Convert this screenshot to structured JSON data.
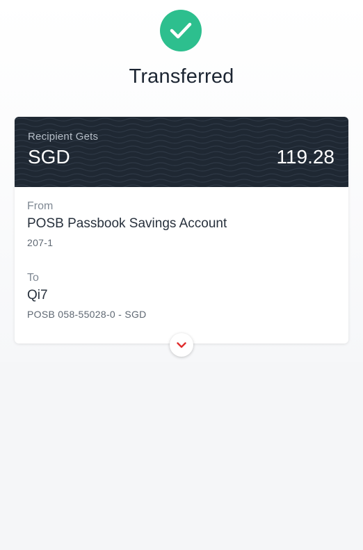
{
  "header": {
    "status_icon": "check-circle-icon",
    "status_color": "#2dbf8e",
    "title": "Transferred"
  },
  "card": {
    "header_bg": "#1f2833",
    "recipient_label": "Recipient Gets",
    "currency": "SGD",
    "amount": "119.28",
    "from": {
      "label": "From",
      "account_name": "POSB Passbook Savings Account",
      "account_number": "207-1"
    },
    "to": {
      "label": "To",
      "name": "Qi7",
      "account": "POSB 058-55028-0 - SGD"
    },
    "expand_icon": "chevron-down-icon",
    "expand_color": "#e02d2d"
  }
}
